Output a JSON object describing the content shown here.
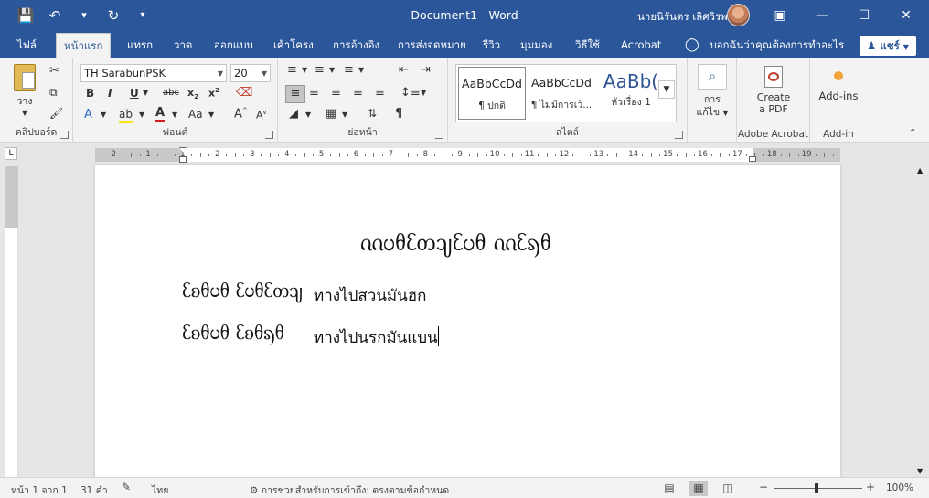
{
  "app": {
    "document_title": "Document1  -  Word",
    "user_name": "นายนิรันดร เลิศวิรพล",
    "accent_color": "#2b579a"
  },
  "quick_access": {
    "save_icon": "save-icon",
    "undo_icon": "undo-icon",
    "redo_icon": "redo-icon",
    "customize_icon": "customize-qat-icon"
  },
  "tabs": [
    {
      "label": "ไฟล์"
    },
    {
      "label": "หน้าแรก",
      "active": true
    },
    {
      "label": "แทรก"
    },
    {
      "label": "วาด"
    },
    {
      "label": "ออกแบบ"
    },
    {
      "label": "เค้าโครง"
    },
    {
      "label": "การอ้างอิง"
    },
    {
      "label": "การส่งจดหมาย"
    },
    {
      "label": "รีวิว"
    },
    {
      "label": "มุมมอง"
    },
    {
      "label": "วิธีใช้"
    },
    {
      "label": "Acrobat"
    }
  ],
  "tell_me": "บอกฉันว่าคุณต้องการทำอะไร",
  "share_label": "แชร์",
  "ribbon": {
    "clipboard": {
      "label": "คลิปบอร์ด",
      "paste_label": "วาง"
    },
    "font": {
      "label": "ฟอนต์",
      "font_name": "TH SarabunPSK",
      "font_size": "20"
    },
    "paragraph": {
      "label": "ย่อหน้า"
    },
    "styles": {
      "label": "สไตล์",
      "items": [
        {
          "sample": "AaBbCcDd",
          "name": "¶ ปกติ"
        },
        {
          "sample": "AaBbCcDd",
          "name": "¶ ไม่มีการเว้..."
        },
        {
          "sample": "AaBb(",
          "name": "หัวเรื่อง 1"
        }
      ]
    },
    "editing": {
      "label_line1": "การ",
      "label_line2": "แก้ไข"
    },
    "adobe": {
      "label": "Adobe Acrobat",
      "button_line1": "Create",
      "button_line2": "a PDF"
    },
    "addin": {
      "label": "Add-in",
      "button": "Add-ins"
    }
  },
  "ruler": {
    "numbers": [
      "2",
      "1",
      "1",
      "2",
      "3",
      "4",
      "5",
      "6",
      "7",
      "8",
      "9",
      "10",
      "11",
      "12",
      "13",
      "14",
      "15",
      "16",
      "17",
      "18",
      "19"
    ]
  },
  "document": {
    "heading": "ᦶᦢᦲᦷᦎᦻᦷᦢᦲ ᦶᦷᦣᦲ",
    "lines": [
      {
        "script": "ᦷᦈᦲᦢᦲ ᦷᦢᦲᦷᦎᦻ",
        "thai": "ทางไปสวนมันฮก"
      },
      {
        "script": "ᦷᦈᦲᦢᦲ ᦷᦈᦲᦣᦲ",
        "thai": "ทางไปนรกมันแบน"
      }
    ]
  },
  "status": {
    "page": "หน้า 1 จาก 1",
    "words": "31 คำ",
    "language": "ไทย",
    "accessibility": "การช่วยสำหรับการเข้าถึง: ตรงตามข้อกำหนด",
    "zoom": "100%"
  }
}
